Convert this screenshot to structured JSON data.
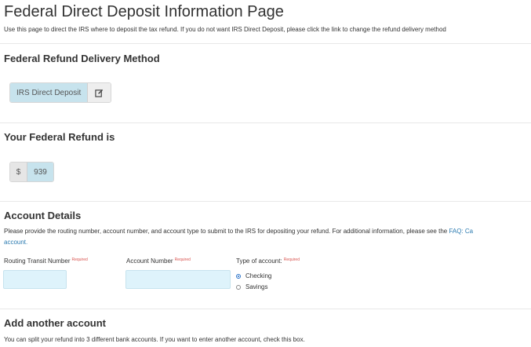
{
  "page": {
    "title": "Federal Direct Deposit Information Page",
    "intro": "Use this page to direct the IRS where to deposit the tax refund. If you do not want IRS Direct Deposit, please click the link to change the refund delivery method"
  },
  "delivery": {
    "heading": "Federal Refund Delivery Method",
    "method_label": "IRS Direct Deposit",
    "edit_icon": "edit-icon"
  },
  "refund": {
    "heading": "Your Federal Refund is",
    "currency": "$",
    "amount": "939"
  },
  "account": {
    "heading": "Account Details",
    "description": "Please provide the routing number, account number, and account type to submit to the IRS for depositing your refund. For additional information, please see the ",
    "faq_link": "FAQ: Ca",
    "desc_line2": "account.",
    "routing_label": "Routing Transit Number",
    "account_label": "Account Number",
    "type_label": "Type of account:",
    "required": "Required",
    "routing_value": "",
    "account_value": "",
    "type_options": [
      "Checking",
      "Savings"
    ],
    "type_selected": "Checking"
  },
  "add_account": {
    "heading": "Add another account",
    "description": "You can split your refund into 3 different bank accounts. If you want to enter another account, check this box."
  },
  "colors": {
    "accent": "#2a7ab0",
    "required": "#d9534f",
    "field_bg": "#def3fb"
  }
}
